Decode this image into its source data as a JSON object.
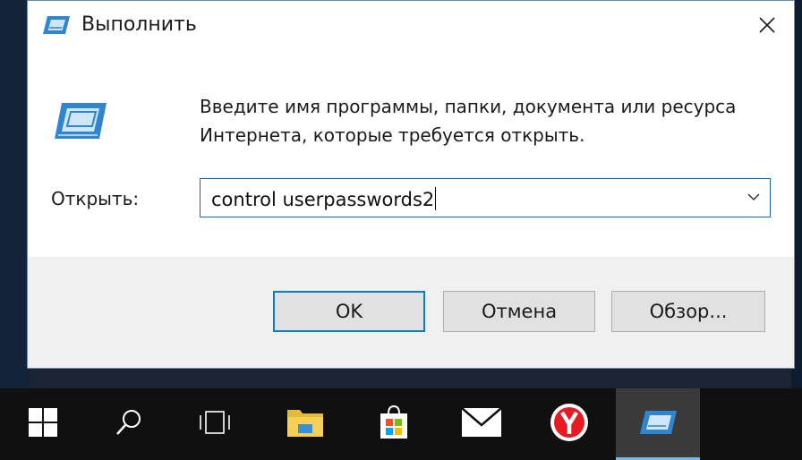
{
  "dialog": {
    "title": "Выполнить",
    "description_line1": "Введите имя программы, папки, документа или ресурса",
    "description_line2": "Интернета, которые требуется открыть.",
    "open_label": "Открыть:",
    "command_value": "control userpasswords2",
    "buttons": {
      "ok": "OK",
      "cancel": "Отмена",
      "browse": "Обзор..."
    }
  },
  "taskbar": {
    "items": [
      "start-icon",
      "search-icon",
      "task-view-icon",
      "file-explorer-icon",
      "store-icon",
      "mail-icon",
      "yandex-browser-icon",
      "run-app-icon"
    ],
    "active_item": "run-app-icon"
  },
  "colors": {
    "accent": "#0b7bd8",
    "taskbar": "#101010",
    "taskbar_active": "#3a3a3a",
    "desktop": "#13243a"
  }
}
